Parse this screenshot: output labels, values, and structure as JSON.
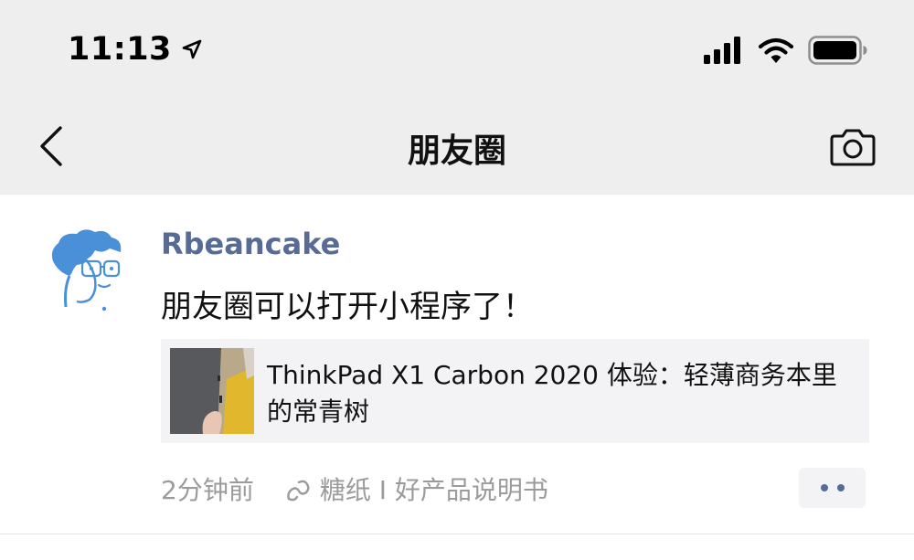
{
  "status_bar": {
    "time": "11:13",
    "icons": [
      "location-arrow-icon",
      "cellular-signal-icon",
      "wifi-icon",
      "battery-icon"
    ]
  },
  "nav": {
    "title": "朋友圈",
    "back_icon": "chevron-left-icon",
    "camera_icon": "camera-icon"
  },
  "post": {
    "username": "Rbeancake",
    "text": "朋友圈可以打开小程序了！",
    "link_card": {
      "title": "ThinkPad X1 Carbon 2020 体验：轻薄商务本里的常青树",
      "thumbnail_icon": "article-thumbnail"
    },
    "time_ago": "2分钟前",
    "source": "糖纸 I 好产品说明书",
    "source_icon": "mini-program-icon",
    "more_icon": "more-dots-icon"
  },
  "colors": {
    "nav_background": "#eeeeee",
    "username": "#576b95",
    "meta_text": "#9b9b9b",
    "card_background": "#f3f3f5"
  }
}
